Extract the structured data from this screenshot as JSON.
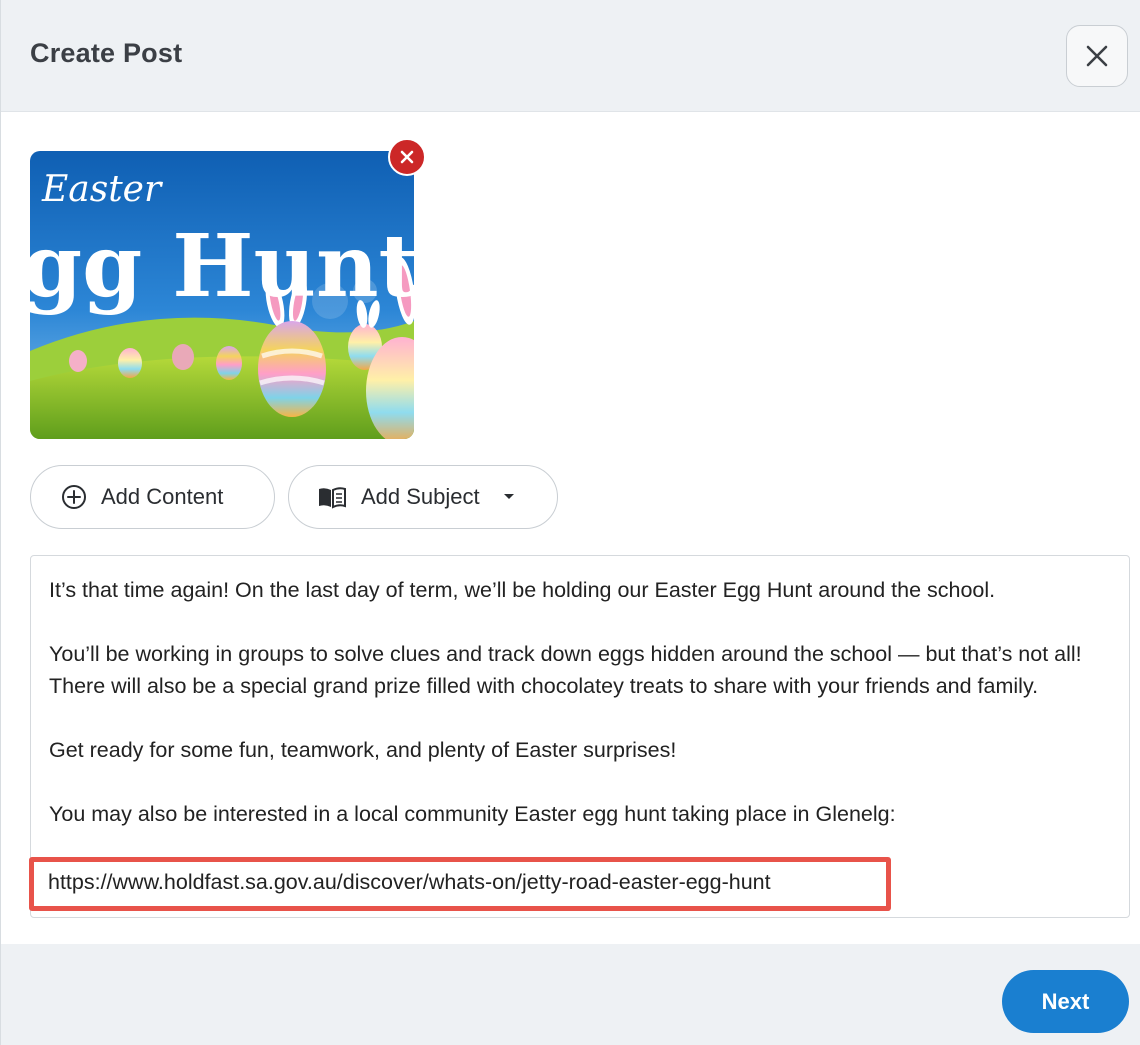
{
  "header": {
    "title": "Create Post",
    "close_icon": "close-icon"
  },
  "image": {
    "remove_icon": "close-icon",
    "script_word": "Easter",
    "headline": "gg Hunt",
    "colors": {
      "sky": "#1d6fc2",
      "grass": "#86bf2a",
      "remove_button": "#cc2727"
    }
  },
  "toolbar": {
    "add_content_label": "Add Content",
    "add_content_icon": "plus-circle-icon",
    "add_subject_label": "Add Subject",
    "add_subject_icon": "book-icon",
    "dropdown_icon": "caret-down-icon"
  },
  "post_body": {
    "paragraphs": [
      "It’s that time again! On the last day of term, we’ll be holding our Easter Egg Hunt around the school.",
      "You’ll be working in groups to solve clues and track down eggs hidden around the school — but that’s not all! There will also be a special grand prize filled with chocolatey treats to share with your friends and family.",
      "Get ready for some fun, teamwork, and plenty of Easter surprises!",
      "You may also be interested in a local community Easter egg hunt taking place in Glenelg:"
    ],
    "link": "https://www.holdfast.sa.gov.au/discover/whats-on/jetty-road-easter-egg-hunt"
  },
  "footer": {
    "next_label": "Next"
  },
  "colors": {
    "accent": "#1a7fd0",
    "highlight": "#e8534a",
    "header_bg": "#eef1f4"
  }
}
